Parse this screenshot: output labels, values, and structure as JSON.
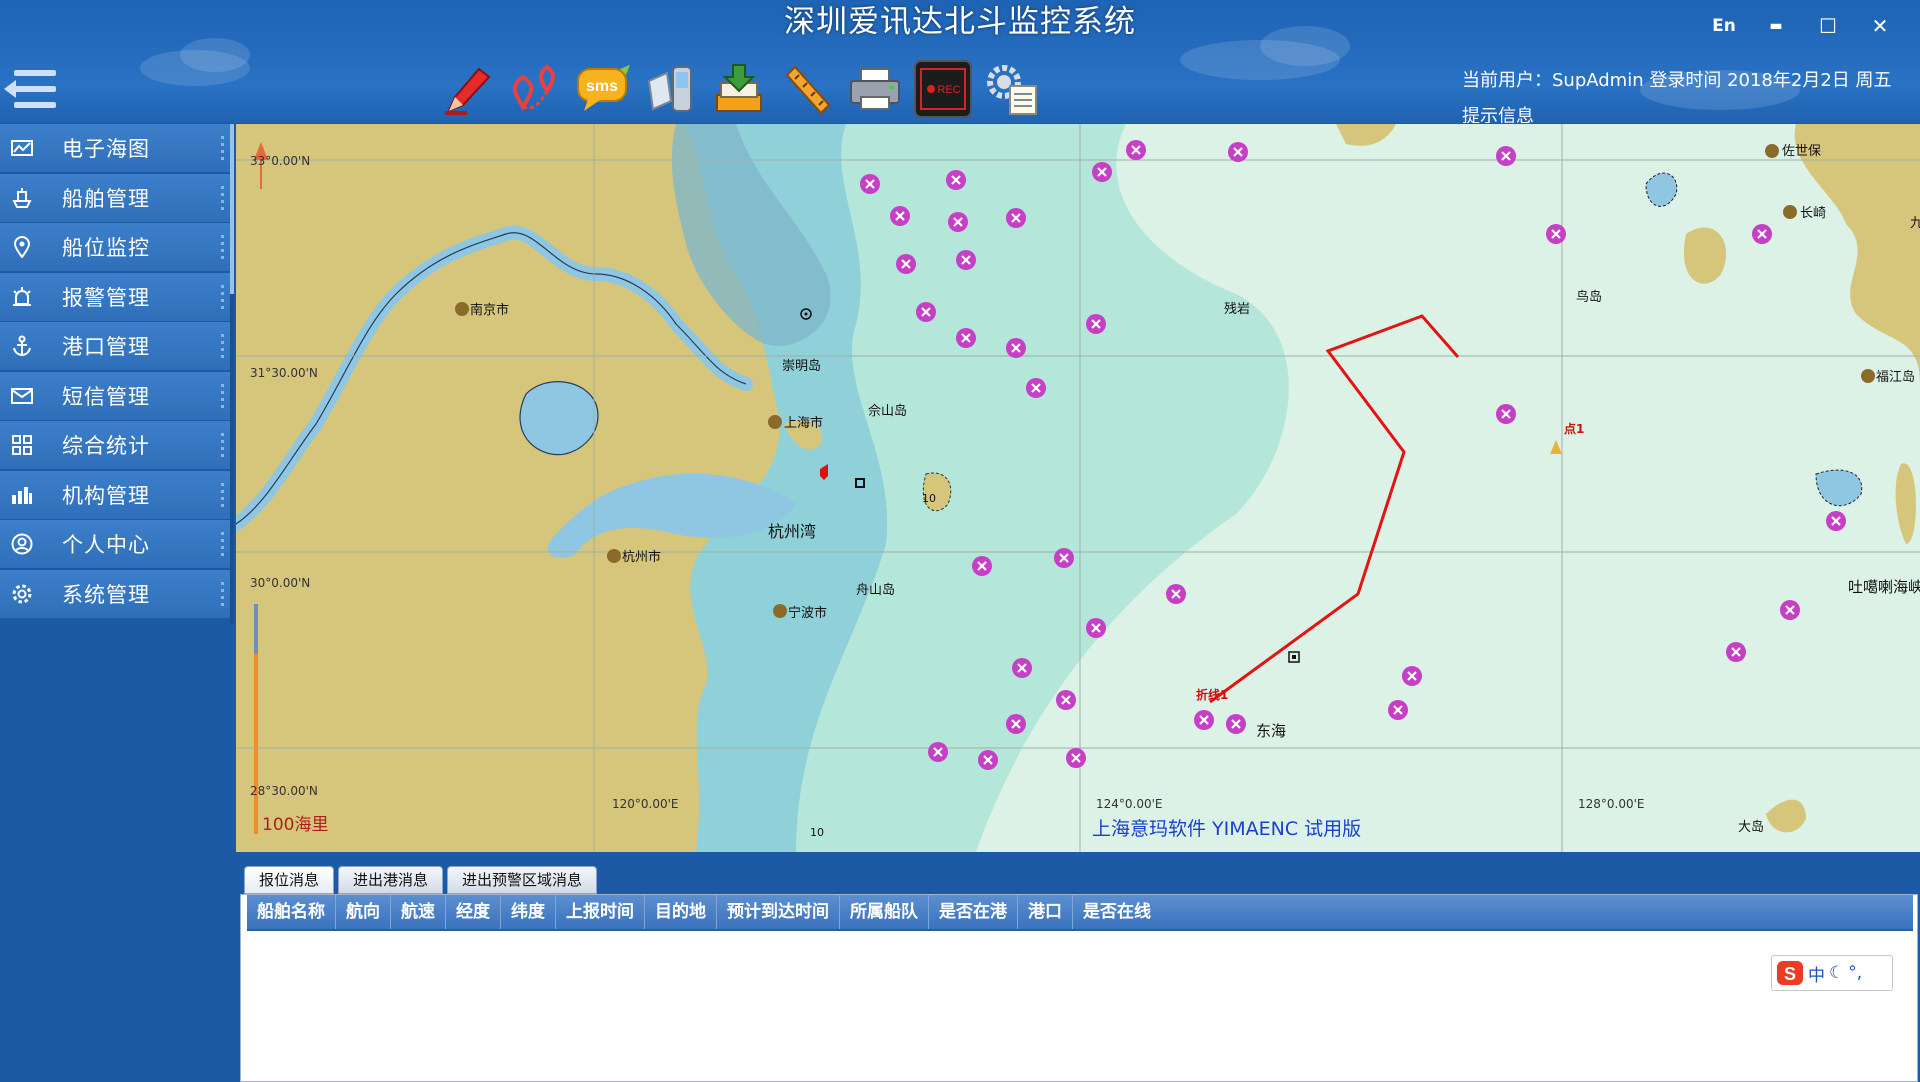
{
  "header": {
    "title": "深圳爱讯达北斗监控系统",
    "user_info": "当前用户：SupAdmin   登录时间 2018年2月2日 周五",
    "tip_info": "提示信息",
    "lang_button": "En",
    "minimize": "▬",
    "maximize": "☐",
    "close": "✕"
  },
  "toolbar": {
    "icons": [
      "marker-icon",
      "route-pins-icon",
      "sms-icon",
      "phone-icon",
      "download-icon",
      "ruler-icon",
      "printer-icon",
      "record-icon",
      "settings-list-icon"
    ],
    "sms_label": "sms",
    "rec_label": "REC"
  },
  "sidebar": {
    "items": [
      {
        "label": "电子海图",
        "icon": "chart-icon"
      },
      {
        "label": "船舶管理",
        "icon": "ship-icon"
      },
      {
        "label": "船位监控",
        "icon": "location-icon"
      },
      {
        "label": "报警管理",
        "icon": "alarm-icon"
      },
      {
        "label": "港口管理",
        "icon": "anchor-icon"
      },
      {
        "label": "短信管理",
        "icon": "mail-icon"
      },
      {
        "label": "综合统计",
        "icon": "stats-icon"
      },
      {
        "label": "机构管理",
        "icon": "org-icon"
      },
      {
        "label": "个人中心",
        "icon": "user-icon"
      },
      {
        "label": "系统管理",
        "icon": "gear-icon"
      }
    ]
  },
  "map": {
    "lat_labels": [
      "33°0.00'N",
      "31°30.00'N",
      "30°0.00'N",
      "28°30.00'N"
    ],
    "lon_labels": [
      "120°0.00'E",
      "124°0.00'E",
      "128°0.00'E"
    ],
    "places": {
      "nanjing": "南京市",
      "chongming": "崇明岛",
      "shanghai": "上海市",
      "sheshan": "佘山岛",
      "hangzhou_bay": "杭州湾",
      "hangzhou": "杭州市",
      "zhoushan": "舟山岛",
      "ningbo": "宁波市",
      "donghai": "东海",
      "sasebo": "佐世保",
      "nagasaki": "长崎",
      "niaodao": "鸟岛",
      "fukue": "福江岛",
      "tokara": "吐噶喇海峡",
      "daodao": "大岛",
      "wuying": "残岩",
      "point1": "点1",
      "polyline": "折线1",
      "depth_10a": "10",
      "depth_10b": "10",
      "jiu": "九"
    },
    "scale": "100海里",
    "watermark": "上海意玛软件 YIMAENC 试用版"
  },
  "bottom": {
    "tabs": [
      "报位消息",
      "进出港消息",
      "进出预警区域消息"
    ],
    "columns": [
      "船舶名称",
      "航向",
      "航速",
      "经度",
      "纬度",
      "上报时间",
      "目的地",
      "预计到达时间",
      "所属船队",
      "是否在港",
      "港口",
      "是否在线"
    ]
  },
  "ime": {
    "label": "中"
  }
}
